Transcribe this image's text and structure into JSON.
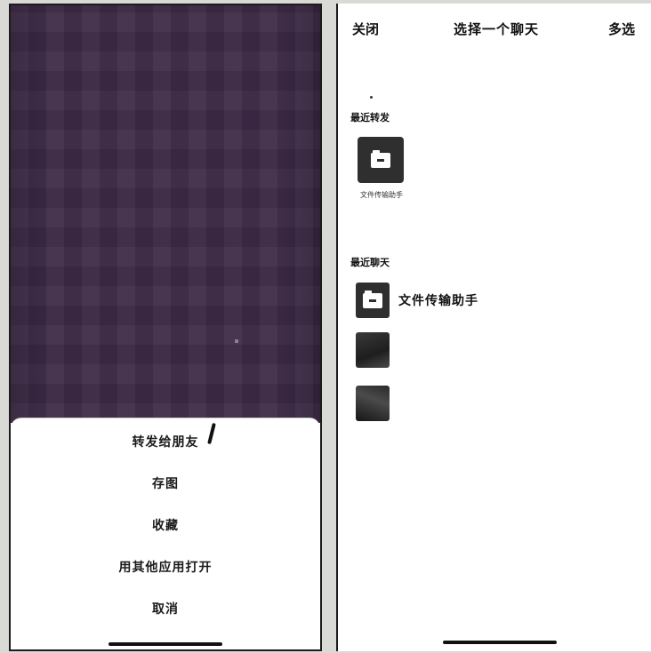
{
  "left_screen": {
    "action_sheet": {
      "items": [
        {
          "label": "转发给朋友"
        },
        {
          "label": "存图"
        },
        {
          "label": "收藏"
        },
        {
          "label": "用其他应用打开"
        },
        {
          "label": "取消"
        }
      ]
    }
  },
  "right_screen": {
    "nav": {
      "close_label": "关闭",
      "title": "选择一个聊天",
      "multi_select_label": "多选"
    },
    "recent_forward": {
      "section_label": "最近转发",
      "items": [
        {
          "name": "文件传输助手",
          "icon": "folder-icon"
        }
      ]
    },
    "recent_chats": {
      "section_label": "最近聊天",
      "hint": "",
      "items": [
        {
          "name": "文件传输助手",
          "icon": "folder-icon"
        },
        {
          "name": "",
          "icon": "avatar-image"
        },
        {
          "name": "",
          "icon": "avatar-image"
        }
      ]
    }
  },
  "colors": {
    "video_background": "#3d2a47",
    "icon_dark": "#2f2f2f",
    "text": "#111111"
  }
}
